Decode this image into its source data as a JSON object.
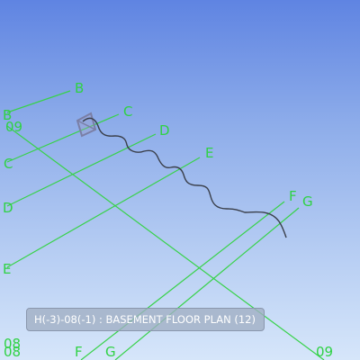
{
  "grid_labels": {
    "B": "B",
    "C": "C",
    "D": "D",
    "E": "E",
    "F": "F",
    "G": "G",
    "row_09": "09",
    "row_08": "08"
  },
  "tooltip": {
    "text": "H(-3)-08(-1) : BASEMENT FLOOR PLAN (12)"
  },
  "colors": {
    "grid": "#38d24a",
    "wire": "#3a3f4a",
    "box": "#7a7fa6"
  },
  "icons": {
    "element_box": "view-box-icon"
  }
}
